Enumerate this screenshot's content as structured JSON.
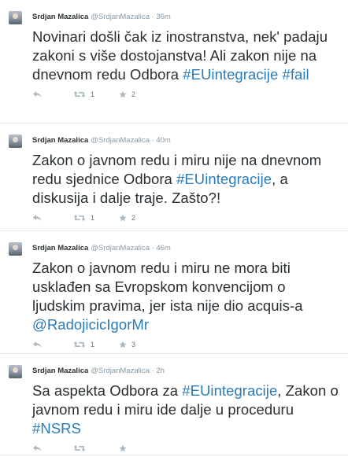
{
  "tweets": [
    {
      "name": "Srdjan Mazalica",
      "handle": "@SrdjanMazalica",
      "dot": "·",
      "time": "36m",
      "text_parts": [
        {
          "t": "Novinari došli čak iz inostranstva, nek' padaju zakoni s više dostojanstva! Ali zakon nije na dnevnom redu Odbora ",
          "tag": false
        },
        {
          "t": "#EUintegracije",
          "tag": true
        },
        {
          "t": " ",
          "tag": false
        },
        {
          "t": "#fail",
          "tag": true
        }
      ],
      "retweets": "1",
      "favorites": "2"
    },
    {
      "name": "Srdjan Mazalica",
      "handle": "@SrdjanMazalica",
      "dot": "·",
      "time": "40m",
      "text_parts": [
        {
          "t": "Zakon o javnom redu i miru nije na dnevnom redu sjednice Odbora ",
          "tag": false
        },
        {
          "t": "#EUintegracije",
          "tag": true
        },
        {
          "t": ", a diskusija i dalje traje. Zašto?!",
          "tag": false
        }
      ],
      "retweets": "1",
      "favorites": "2"
    },
    {
      "name": "Srdjan Mazalica",
      "handle": "@SrdjanMazalica",
      "dot": "·",
      "time": "46m",
      "text_parts": [
        {
          "t": "Zakon o javnom redu i miru ne mora biti usklađen sa Evropskom konvencijom o ljudskim pravima, jer ista nije dio acquis-a ",
          "tag": false
        },
        {
          "t": "@RadojicicIgorMr",
          "tag": true
        }
      ],
      "retweets": "1",
      "favorites": "3"
    },
    {
      "name": "Srdjan Mazalica",
      "handle": "@SrdjanMazalica",
      "dot": "·",
      "time": "2h",
      "text_parts": [
        {
          "t": "Sa aspekta Odbora za ",
          "tag": false
        },
        {
          "t": "#EUintegracije",
          "tag": true
        },
        {
          "t": ", Zakon o javnom redu i miru ide dalje u proceduru ",
          "tag": false
        },
        {
          "t": "#NSRS",
          "tag": true
        }
      ],
      "retweets": "",
      "favorites": ""
    }
  ],
  "colors": {
    "link": "#2b7bb9",
    "muted": "#8899a6",
    "text": "#292f33",
    "border": "#e1e8ed"
  },
  "icons": {
    "reply": "reply-icon",
    "retweet": "retweet-icon",
    "favorite": "favorite-icon"
  }
}
